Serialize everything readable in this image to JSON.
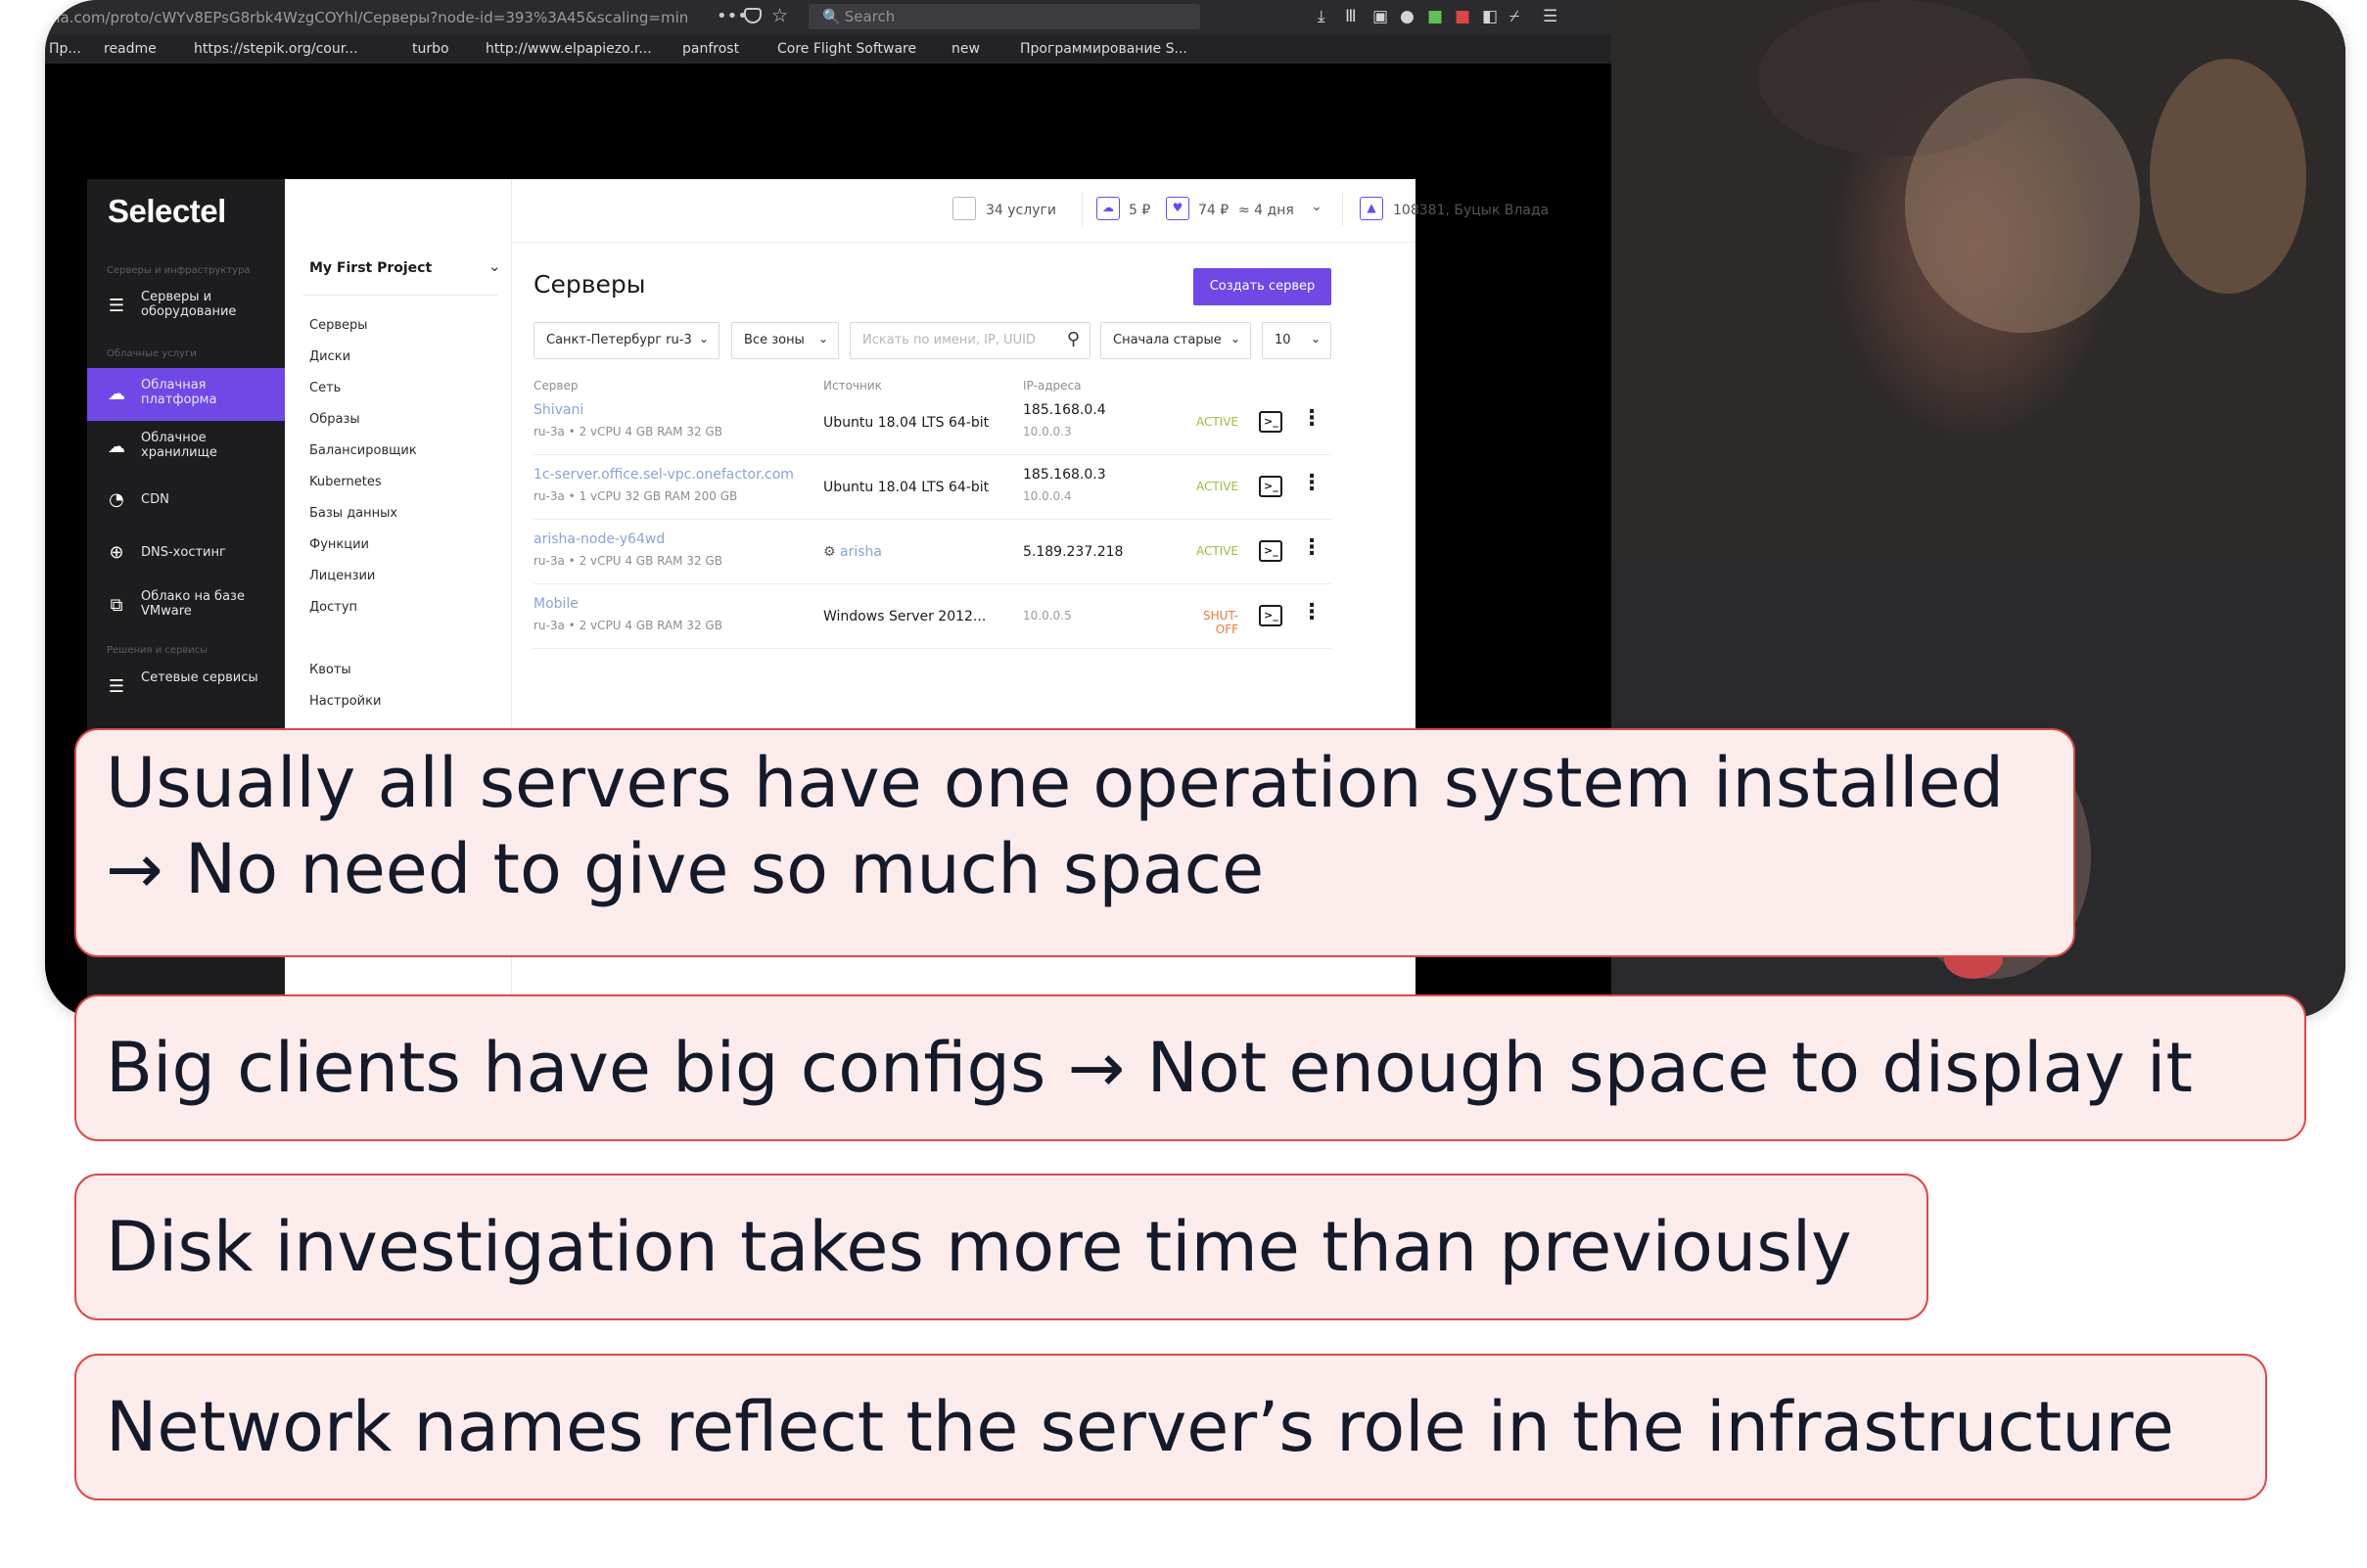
{
  "browser": {
    "url": "na.com/proto/cWYv8EPsG8rbk4WzgCOYhl/Серверы?node-id=393%3A45&scaling=min",
    "search_placeholder": "Search",
    "bookmarks": [
      "Пр...",
      "readme",
      "https://stepik.org/cour...",
      "turbo",
      "http://www.elpapiezo.r...",
      "panfrost",
      "Core Flight Software",
      "new",
      "Программирование S..."
    ]
  },
  "app": {
    "logo": "Selectel",
    "sidebar": {
      "section1": "Серверы и инфраструктура",
      "section2": "Облачные услуги",
      "section3": "Решения и сервисы",
      "items": [
        {
          "label": "Серверы и оборудование",
          "icon": "servers-icon"
        },
        {
          "label": "Облачная платформа",
          "icon": "cloud-icon",
          "active": true
        },
        {
          "label": "Облачное хранилище",
          "icon": "cloud-upload-icon"
        },
        {
          "label": "CDN",
          "icon": "cdn-icon"
        },
        {
          "label": "DNS-хостинг",
          "icon": "globe-icon"
        },
        {
          "label": "Облако на базе VMware",
          "icon": "vmware-icon"
        },
        {
          "label": "Сетевые сервисы",
          "icon": "network-icon"
        }
      ]
    },
    "submenu": {
      "project": "My First Project",
      "items": [
        "Серверы",
        "Диски",
        "Сеть",
        "Образы",
        "Балансировщик",
        "Kubernetes",
        "Базы данных",
        "Функции",
        "Лицензии",
        "Доступ"
      ],
      "items_bottom": [
        "Квоты",
        "Настройки"
      ]
    },
    "topbar": {
      "services": "34 услуги",
      "balance1": "5 ₽",
      "balance2": "74 ₽",
      "days": "≈ 4 дня",
      "account": "108381, Буцык Влада"
    },
    "title": "Серверы",
    "create_button": "Создать сервер",
    "filters": {
      "region": "Санкт-Петербург ru-3",
      "zones": "Все зоны",
      "search_placeholder": "Искать по имени, IP, UUID",
      "sort": "Сначала старые",
      "per_page": "10"
    },
    "columns": [
      "Сервер",
      "Источник",
      "IP-адреса"
    ],
    "servers": [
      {
        "name": "Shivani",
        "spec": "ru-3a • 2 vCPU  4 GB RAM  32 GB",
        "source": "Ubuntu 18.04 LTS 64-bit",
        "ip": "185.168.0.4",
        "ip2": "10.0.0.3",
        "status": "ACTIVE"
      },
      {
        "name": "1c-server.office.sel-vpc.onefactor.com",
        "spec": "ru-3a • 1 vCPU  32 GB RAM  200 GB",
        "source": "Ubuntu 18.04 LTS 64-bit",
        "ip": "185.168.0.3",
        "ip2": "10.0.0.4",
        "status": "ACTIVE"
      },
      {
        "name": "arisha-node-y64wd",
        "spec": "ru-3a • 2 vCPU  4 GB RAM  32 GB",
        "source": "arisha",
        "ip": "5.189.237.218",
        "ip2": "",
        "status": "ACTIVE"
      },
      {
        "name": "Mobile",
        "spec": "ru-3a • 2 vCPU  4 GB RAM  32 GB",
        "source": "Windows Server 2012...",
        "ip": "10.0.0.5",
        "ip2": "",
        "status": "SHUT-OFF"
      }
    ]
  },
  "notes": [
    {
      "line1": "Usually all servers have one operation system installed",
      "line2": "→ No need to give so much space"
    },
    {
      "line1": "Big clients have big configs → Not enough space to display it"
    },
    {
      "line1": "Disk investigation takes more time than previously"
    },
    {
      "line1": "Network names reflect the server’s role in the infrastructure"
    }
  ],
  "colors": {
    "accent": "#6f48e6",
    "note_border": "#d94a4a",
    "note_bg": "#fcecec",
    "active": "#9dbf3a",
    "shutoff": "#e8793a"
  }
}
